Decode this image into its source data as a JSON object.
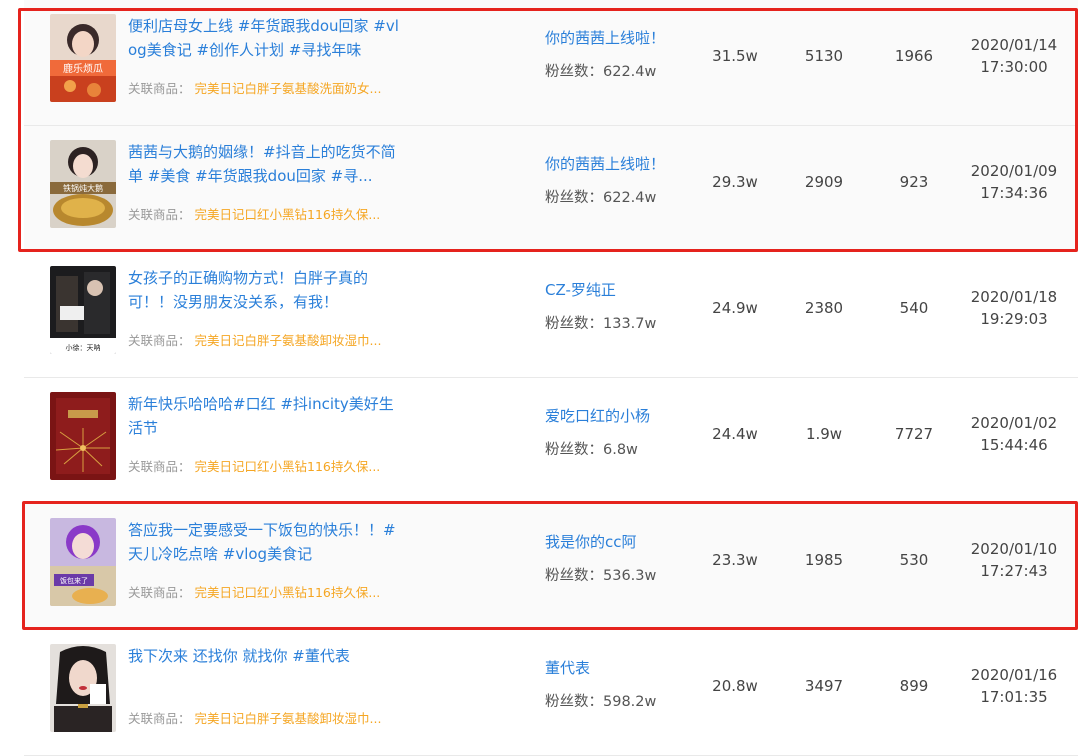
{
  "rows": [
    {
      "title": "便利店母女上线 #年货跟我dou回家 #vlog美食记 #创作人计划 #寻找年味",
      "product_label": "关联商品：",
      "product": "完美日记白胖子氨基酸洗面奶女...",
      "author": "你的茜茜上线啦！",
      "fans_label": "粉丝数：",
      "fans": "622.4w",
      "likes": "31.5w",
      "comments": "5130",
      "shares": "1966",
      "date": "2020/01/14",
      "time": "17:30:00",
      "thumb_text": "鹿乐烦瓜"
    },
    {
      "title": "茜茜与大鹅的姻缘！#抖音上的吃货不简单 #美食 #年货跟我dou回家 #寻...",
      "product_label": "关联商品：",
      "product": "完美日记口红小黑钻116持久保...",
      "author": "你的茜茜上线啦！",
      "fans_label": "粉丝数：",
      "fans": "622.4w",
      "likes": "29.3w",
      "comments": "2909",
      "shares": "923",
      "date": "2020/01/09",
      "time": "17:34:36",
      "thumb_text": "铁锅炖大鹅"
    },
    {
      "title": "女孩子的正确购物方式！白胖子真的可！！没男朋友没关系，有我！",
      "product_label": "关联商品：",
      "product": "完美日记白胖子氨基酸卸妆湿巾...",
      "author": "CZ-罗纯正",
      "fans_label": "粉丝数：",
      "fans": "133.7w",
      "likes": "24.9w",
      "comments": "2380",
      "shares": "540",
      "date": "2020/01/18",
      "time": "19:29:03",
      "thumb_text": "小徐：天呐"
    },
    {
      "title": "新年快乐哈哈哈#口红 #抖incity美好生活节",
      "product_label": "关联商品：",
      "product": "完美日记口红小黑钻116持久保...",
      "author": "爱吃口红的小杨",
      "fans_label": "粉丝数：",
      "fans": "6.8w",
      "likes": "24.4w",
      "comments": "1.9w",
      "shares": "7727",
      "date": "2020/01/02",
      "time": "15:44:46",
      "thumb_text": ""
    },
    {
      "title": "答应我一定要感受一下饭包的快乐！！#天儿冷吃点啥 #vlog美食记",
      "product_label": "关联商品：",
      "product": "完美日记口红小黑钻116持久保...",
      "author": "我是你的cc阿",
      "fans_label": "粉丝数：",
      "fans": "536.3w",
      "likes": "23.3w",
      "comments": "1985",
      "shares": "530",
      "date": "2020/01/10",
      "time": "17:27:43",
      "thumb_text": "饭包来了"
    },
    {
      "title": "我下次来 还找你 就找你 #董代表",
      "product_label": "关联商品：",
      "product": "完美日记白胖子氨基酸卸妆湿巾...",
      "author": "董代表",
      "fans_label": "粉丝数：",
      "fans": "598.2w",
      "likes": "20.8w",
      "comments": "3497",
      "shares": "899",
      "date": "2020/01/16",
      "time": "17:01:35",
      "thumb_text": ""
    }
  ],
  "colors": {
    "link": "#2a7fd9",
    "product": "#f5a623",
    "highlight": "#e5231d"
  }
}
